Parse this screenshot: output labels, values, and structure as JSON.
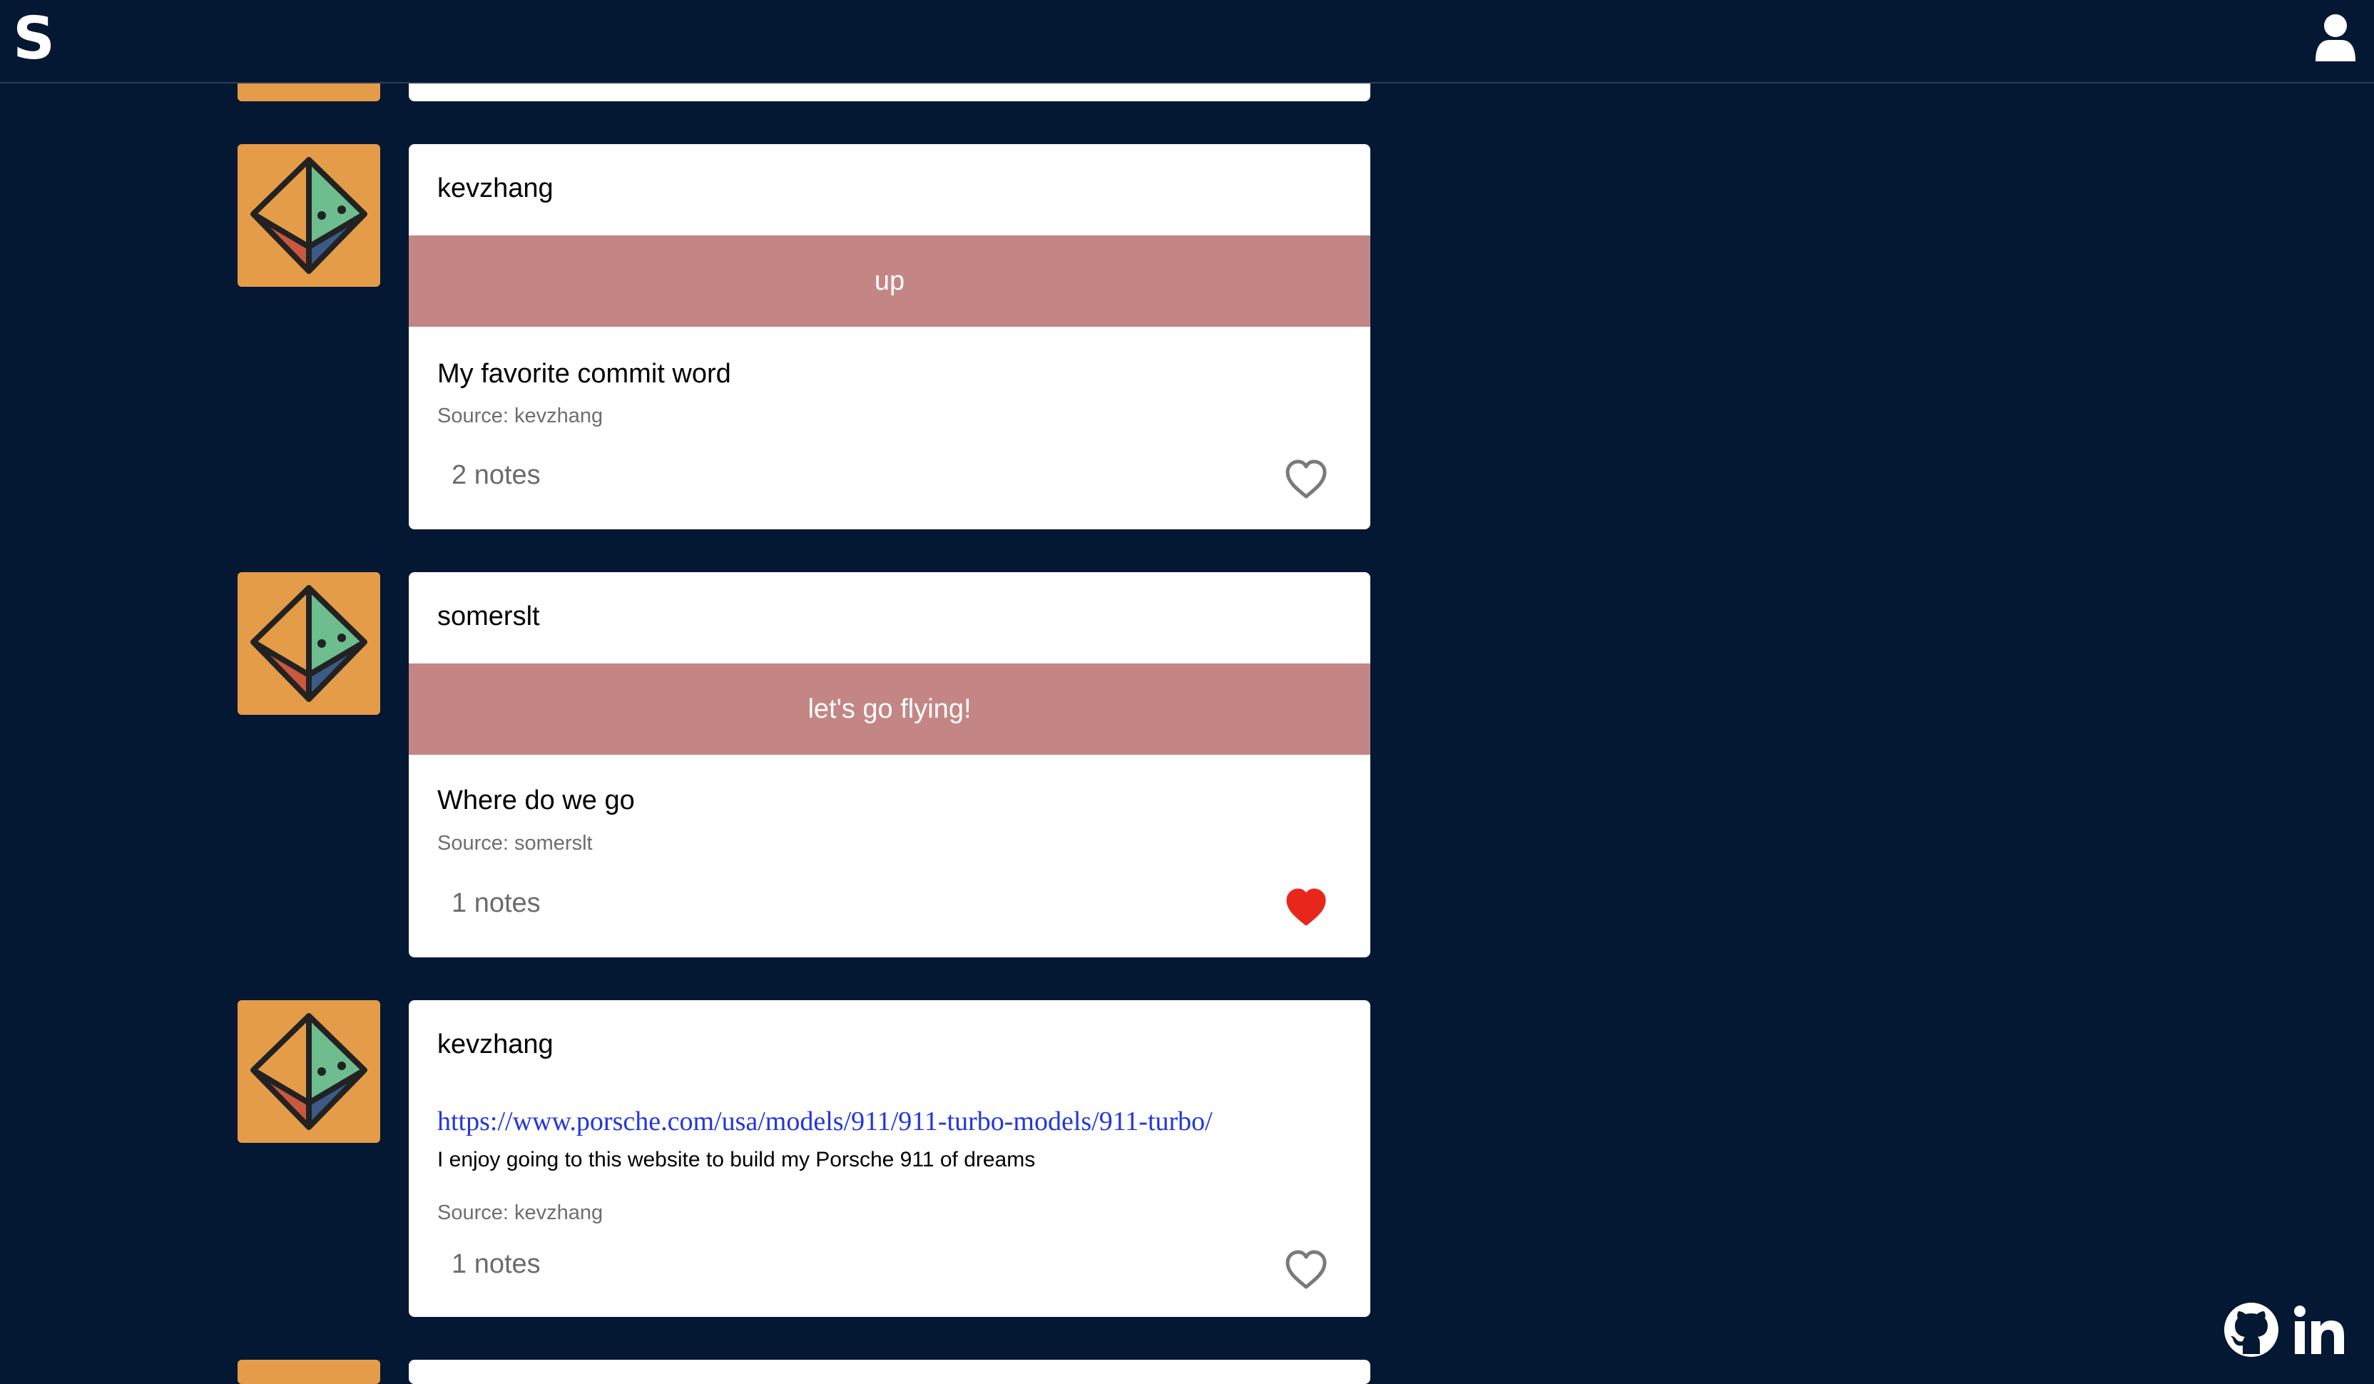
{
  "header": {
    "logo": "S",
    "logo_icon": "s-logo",
    "user_icon": "user-icon"
  },
  "posts": [
    {
      "username": "kevzhang",
      "banner": "up",
      "title": "My favorite commit word",
      "source": "Source: kevzhang",
      "notes": "2 notes",
      "liked": false
    },
    {
      "username": "somerslt",
      "banner": "let's go flying!",
      "title": "Where do we go",
      "source": "Source: somerslt",
      "notes": "1 notes",
      "liked": true
    },
    {
      "username": "kevzhang",
      "link": "https://www.porsche.com/usa/models/911/911-turbo-models/911-turbo/",
      "description": "I enjoy going to this website to build my Porsche 911 of dreams",
      "source": "Source: kevzhang",
      "notes": "1 notes",
      "liked": false
    }
  ],
  "footer": {
    "github_icon": "github-icon",
    "linkedin_icon": "linkedin-icon"
  },
  "colors": {
    "background": "#041733",
    "banner": "#c38685",
    "avatar_bg": "#e49c48",
    "heart_liked": "#e8271c",
    "heart_unliked": "#7a7a7a",
    "link": "#2236e0"
  }
}
